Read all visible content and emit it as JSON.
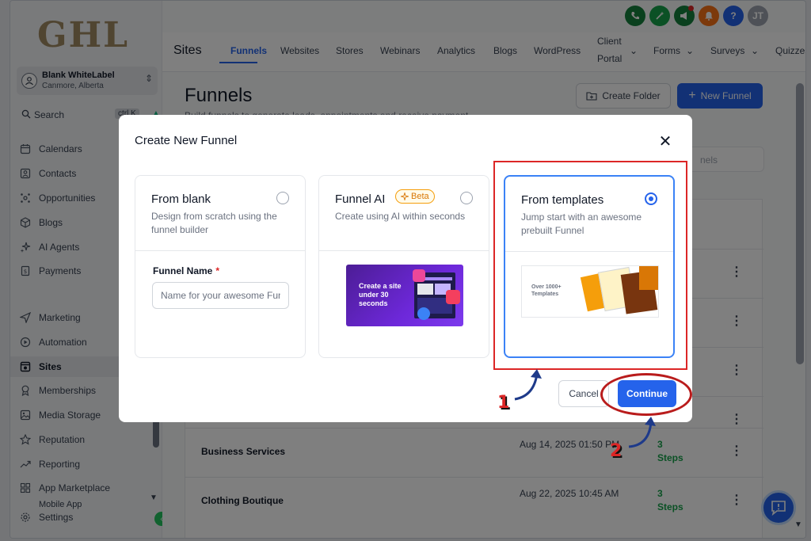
{
  "app": {
    "logo_text": "GHL",
    "location_name": "Blank WhiteLabel",
    "location_city": "Canmore, Alberta",
    "search_label": "Search",
    "search_shortcut": "ctrl K",
    "user_initials": "JT"
  },
  "sidebar": {
    "items": [
      {
        "label": "Calendars",
        "icon": "calendar-icon"
      },
      {
        "label": "Contacts",
        "icon": "contacts-icon"
      },
      {
        "label": "Opportunities",
        "icon": "opportunities-icon"
      },
      {
        "label": "Blogs",
        "icon": "blog-cube-icon"
      },
      {
        "label": "AI Agents",
        "icon": "sparkle-icon"
      },
      {
        "label": "Payments",
        "icon": "payments-icon"
      },
      {
        "label": "Marketing",
        "icon": "send-icon"
      },
      {
        "label": "Automation",
        "icon": "automation-icon"
      },
      {
        "label": "Sites",
        "icon": "sites-icon"
      },
      {
        "label": "Memberships",
        "icon": "award-icon"
      },
      {
        "label": "Media Storage",
        "icon": "image-icon"
      },
      {
        "label": "Reputation",
        "icon": "star-icon"
      },
      {
        "label": "Reporting",
        "icon": "trend-icon"
      },
      {
        "label": "App Marketplace",
        "icon": "grid-icon"
      },
      {
        "label": "Mobile App",
        "icon": "mobile-icon"
      },
      {
        "label": "Settings",
        "icon": "gear-icon"
      }
    ]
  },
  "topnav": {
    "section": "Sites",
    "tabs": [
      "Funnels",
      "Websites",
      "Stores",
      "Webinars",
      "Analytics",
      "Blogs",
      "WordPress",
      "Client",
      "Portal",
      "Forms",
      "Surveys",
      "Quizzes"
    ]
  },
  "main": {
    "title": "Funnels",
    "subtitle": "Build funnels to generate leads, appointments and receive payment",
    "create_folder": "Create Folder",
    "new_funnel": "New Funnel",
    "search_placeholder": "nels",
    "rows": [
      {
        "name": "Business Services",
        "date": "Aug 14, 2025 01:50 PM",
        "steps": "3 Steps"
      },
      {
        "name": "Clothing Boutique",
        "date": "Aug 22, 2025 10:45 AM",
        "steps": "3 Steps"
      }
    ]
  },
  "modal": {
    "title": "Create New Funnel",
    "options": [
      {
        "title": "From blank",
        "desc": "Design from scratch using the funnel builder",
        "selected": false
      },
      {
        "title": "Funnel AI",
        "desc": "Create using AI within seconds",
        "badge": "Beta",
        "selected": false
      },
      {
        "title": "From templates",
        "desc": "Jump start with an awesome prebuilt Funnel",
        "selected": true
      }
    ],
    "funnel_name_label": "Funnel Name",
    "funnel_name_required": "*",
    "funnel_name_placeholder": "Name for your awesome Funnel",
    "ai_thumb_text": "Create a site under 30 seconds",
    "templates_thumb_text": "Over 1000+ Templates",
    "cancel": "Cancel",
    "continue": "Continue"
  },
  "annotations": {
    "step1": "1",
    "step2": "2"
  },
  "colors": {
    "accent": "#2563eb",
    "annotation_red": "#dc2626",
    "steps_green": "#16a34a"
  }
}
